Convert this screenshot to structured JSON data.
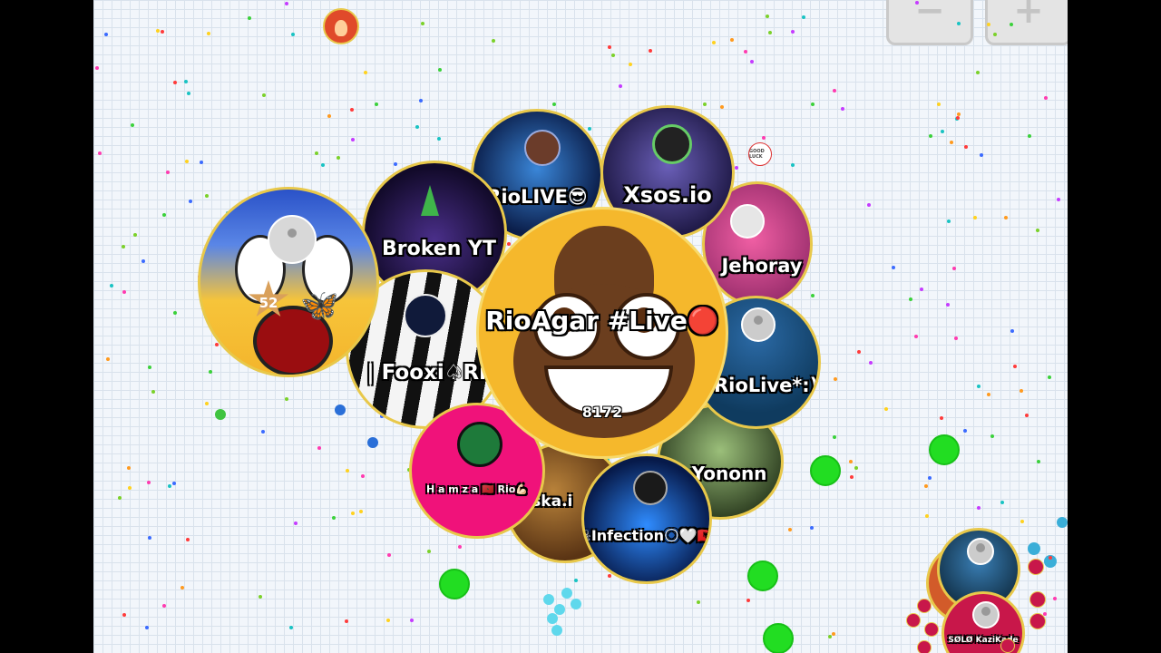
{
  "colors": {
    "background": "#f2f6fb",
    "grid_line": "#d9e2ec",
    "virus": "#22dd22",
    "cell_border": "#e8c84a"
  },
  "controls": {
    "minus_label": "−",
    "plus_label": "+"
  },
  "player": {
    "name": "RioAgar #Live🔴",
    "mass": "8172"
  },
  "cells": [
    {
      "name": "RioLIVE😎"
    },
    {
      "name": "Xsos.io"
    },
    {
      "name": "Broken YT"
    },
    {
      "name": "Jehoray"
    },
    {
      "name": "| Fooxi♤Rio"
    },
    {
      "name": "RioLive*:)"
    },
    {
      "name": "Yononn"
    },
    {
      "name": "H a m z a 🇲🇦 Rio💪🏻"
    },
    {
      "name": "eska.i"
    },
    {
      "name": "☠Infection🌕🤍🇦🇱"
    },
    {
      "name": "SØLØ KaziKade"
    }
  ],
  "level_badge": "52",
  "small_cell_label": "GOOD LUCK"
}
